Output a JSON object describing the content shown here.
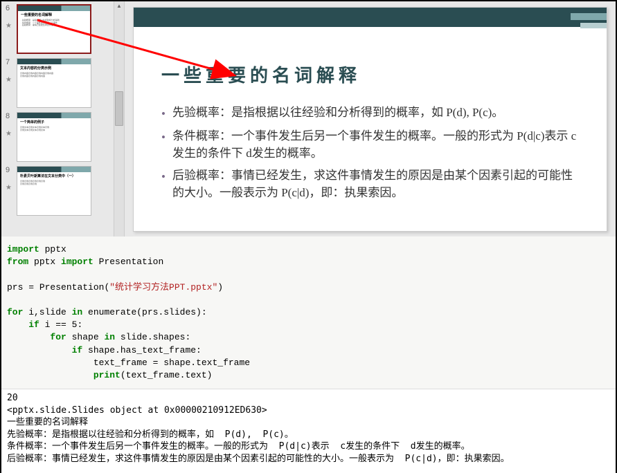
{
  "thumbs": [
    {
      "num": "6",
      "title": "一些重要的名词解释",
      "selected": true
    },
    {
      "num": "7",
      "title": "文本内容的分类示例",
      "selected": false
    },
    {
      "num": "8",
      "title": "一个简单的例子",
      "selected": false
    },
    {
      "num": "9",
      "title": "朴素贝叶斯算法在文本分类中（一）",
      "selected": false
    }
  ],
  "slide": {
    "title": "一些重要的名词解释",
    "bullets": [
      "先验概率：是指根据以往经验和分析得到的概率，如 P(d), P(c)。",
      "条件概率：一个事件发生后另一个事件发生的概率。一般的形式为 P(d|c)表示 c发生的条件下 d发生的概率。",
      "后验概率：事情已经发生，求这件事情发生的原因是由某个因素引起的可能性的大小。一般表示为 P(c|d)，即：执果索因。"
    ]
  },
  "code": {
    "l1_kw1": "import",
    "l1_mod": " pptx",
    "l2_kw1": "from",
    "l2_mod": " pptx ",
    "l2_kw2": "import",
    "l2_cls": " Presentation",
    "l3_var": "prs ",
    "l3_eq": "=",
    "l3_cls": " Presentation(",
    "l3_str": "\"统计学习方法PPT.pptx\"",
    "l3_end": ")",
    "l4_kw1": "for",
    "l4_mid": " i,slide ",
    "l4_kw2": "in",
    "l4_call": " enumerate(prs.slides):",
    "l5_pad": "    ",
    "l5_kw1": "if",
    "l5_cond": " i ",
    "l5_eq": "==",
    "l5_val": " 5:",
    "l6_pad": "        ",
    "l6_kw1": "for",
    "l6_mid": " shape ",
    "l6_kw2": "in",
    "l6_end": " slide.shapes:",
    "l7_pad": "            ",
    "l7_kw1": "if",
    "l7_cond": " shape.has_text_frame:",
    "l8_pad": "                ",
    "l8_txt": "text_frame ",
    "l8_eq": "=",
    "l8_end": " shape.text_frame",
    "l9_pad": "                ",
    "l9_fn": "print",
    "l9_arg": "(text_frame.text)"
  },
  "output": {
    "l1": "20",
    "l2": "<pptx.slide.Slides object at 0x00000210912ED630>",
    "l3": "一些重要的名词解释",
    "l4": "先验概率：是指根据以往经验和分析得到的概率，如  P(d),  P(c)。",
    "l5": "条件概率：一个事件发生后另一个事件发生的概率。一般的形式为  P(d|c)表示  c发生的条件下  d发生的概率。",
    "l6": "后验概率：事情已经发生，求这件事情发生的原因是由某个因素引起的可能性的大小。一般表示为  P(c|d)，即：执果索因。"
  }
}
